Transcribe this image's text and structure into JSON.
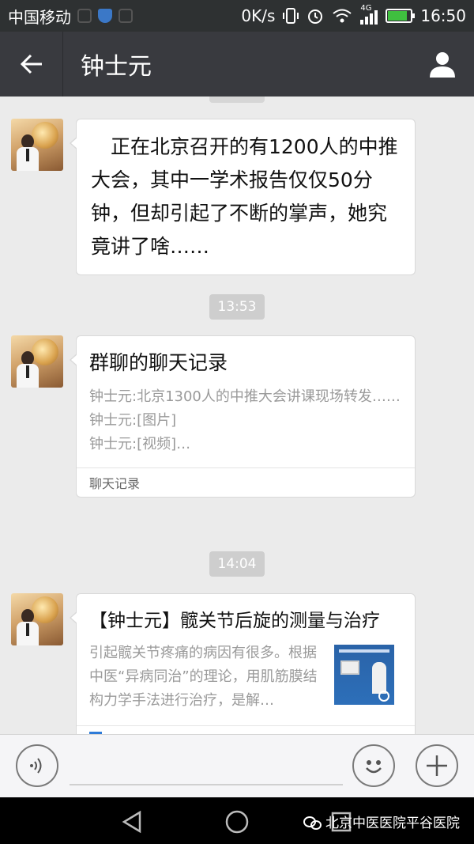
{
  "status_bar": {
    "carrier": "中国移动",
    "network_speed": "0K/s",
    "network_type": "4G",
    "time": "16:50"
  },
  "header": {
    "title": "钟士元"
  },
  "messages": [
    {
      "type": "text",
      "text": "正在北京召开的有1200人的中推大会，其中一学术报告仅仅50分钟，但却引起了不断的掌声，她究竟讲了啥……"
    },
    {
      "type": "timestamp",
      "text": "13:53"
    },
    {
      "type": "chat_record",
      "title": "群聊的聊天记录",
      "lines": [
        "钟士元:北京1300人的中推大会讲课现场转发……",
        "钟士元:[图片]",
        "钟士元:[视频]…"
      ],
      "footer": "聊天记录"
    },
    {
      "type": "timestamp",
      "text": "14:04"
    },
    {
      "type": "article",
      "title": "【钟士元】髋关节后旋的测量与治疗",
      "summary": "引起髋关节疼痛的病因有很多。根据中医“异病同治”的理论，用肌筋膜结构力学手法进行治疗，是解…"
    }
  ],
  "bottom_watermark": "北京中医医院平谷医院",
  "colors": {
    "status_bar_bg": "#2e3132",
    "nav_bg": "#393a3f",
    "chat_bg": "#ebebeb",
    "bubble_bg": "#ffffff",
    "timestamp_bg": "#cecece"
  },
  "icons": [
    "back-arrow-icon",
    "user-profile-icon",
    "voice-icon",
    "emoji-icon",
    "plus-icon",
    "android-back-icon",
    "android-home-icon",
    "android-recents-icon",
    "wechat-icon"
  ]
}
